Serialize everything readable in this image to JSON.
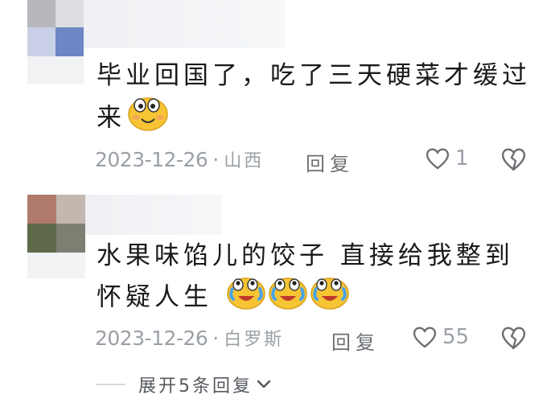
{
  "comments": [
    {
      "text_line1": "毕业回国了，吃了三天硬菜才缓过",
      "text_line2": "来",
      "emoji": "smile-emoji",
      "date": "2023-12-26",
      "location": "山西",
      "reply_label": "回复",
      "like_count": "1"
    },
    {
      "text_line1": "水果味馅儿的饺子 直接给我整到",
      "text_line2": "怀疑人生",
      "emoji": "cry-laugh-emoji",
      "date": "2023-12-26",
      "location": "白罗斯",
      "reply_label": "回复",
      "like_count": "55"
    }
  ],
  "expand_replies_label": "展开5条回复",
  "icons": [
    "heart-icon",
    "broken-heart-icon",
    "chevron-down-icon"
  ],
  "colors": {
    "text": "#1a1a1a",
    "meta": "#9aa0a6",
    "emoji": "#f6c434"
  }
}
